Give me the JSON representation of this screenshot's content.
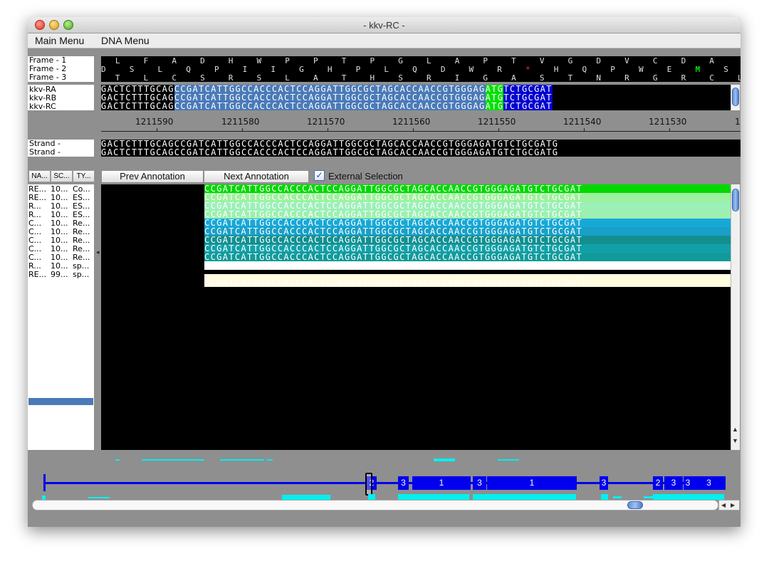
{
  "window": {
    "title": "- kkv-RC -"
  },
  "menus": [
    "Main Menu",
    "DNA Menu"
  ],
  "frames": {
    "labels": [
      "Frame - 1",
      "Frame - 2",
      "Frame - 3"
    ],
    "row1": "   L     F     A     D     H     W     P     P     T     P     G     L     A     P     T     V     G     D     V     C     D     A",
    "row2": "D     S     L     Q     P     I     I     G     H     P     L     Q     D     W     R     *     H     Q     P     W     E     M     S     A     M",
    "row3": "   T     L     C     S     R     S     L     A     T     H     S     R     I     G     A     S     T     N     R     G     R     C     L     R     C"
  },
  "transcripts": {
    "labels": [
      "kkv-RA",
      "kkv-RB",
      "kkv-RC"
    ],
    "seq_black": "GACTCTTTGCAG",
    "seq_blue": "CCGATCATTGGCCACCCACTCCAGGATTGGCGCTAGCACCAACCGTGGGAG",
    "seq_green": "ATG",
    "seq_dark": "TCTGCGAT"
  },
  "ruler": {
    "ticks": [
      "1211590",
      "1211580",
      "1211570",
      "1211560",
      "1211550",
      "1211540",
      "1211530",
      "1"
    ]
  },
  "strand": {
    "labels": [
      "Strand -",
      "Strand -"
    ],
    "seq": "GACTCTTTGCAGCCGATCATTGGCCACCCACTCCAGGATTGGCGCTAGCACCAACCGTGGGAGATGTCTGCGATG"
  },
  "annotation_table": {
    "headers": [
      "NA...",
      "SC...",
      "TY..."
    ],
    "rows": [
      [
        "RE...",
        "10...",
        "Co..."
      ],
      [
        "RE...",
        "10...",
        "ES..."
      ],
      [
        "R...",
        "10...",
        "ES..."
      ],
      [
        "R...",
        "10...",
        "ES..."
      ],
      [
        "C...",
        "10...",
        "Re..."
      ],
      [
        "C...",
        "10...",
        "Re..."
      ],
      [
        "C...",
        "10...",
        "Re..."
      ],
      [
        "C...",
        "10...",
        "Re..."
      ],
      [
        "C...",
        "10...",
        "Re..."
      ],
      [
        "R...",
        "10...",
        "sp..."
      ],
      [
        "RE...",
        "99...",
        "sp..."
      ]
    ]
  },
  "buttons": {
    "prev": "Prev Annotation",
    "next": "Next Annotation"
  },
  "external_selection": {
    "label": "External Selection",
    "checked": true
  },
  "annotation_seq": "CCGATCATTGGCCACCCACTCCAGGATTGGCGCTAGCACCAACCGTGGGAGATGTCTGCGAT",
  "annotation_colors": [
    "#00d800",
    "#9cf29c",
    "#9cf0b8",
    "#9cf0b0",
    "#18a8d8",
    "#18a0c8",
    "#138f8f",
    "#12a0a8",
    "#109a9a",
    "#ffffff",
    "#fffce0"
  ],
  "overview": {
    "exon_labels": [
      "2",
      "3",
      "1",
      "3",
      "1",
      "3",
      "2",
      "3",
      "3",
      "3"
    ]
  },
  "colors": {
    "green_hi": "#00e000",
    "blue_track": "#4a7ab8",
    "exon_blue": "#0000ee",
    "cyan": "#00f0f0"
  }
}
